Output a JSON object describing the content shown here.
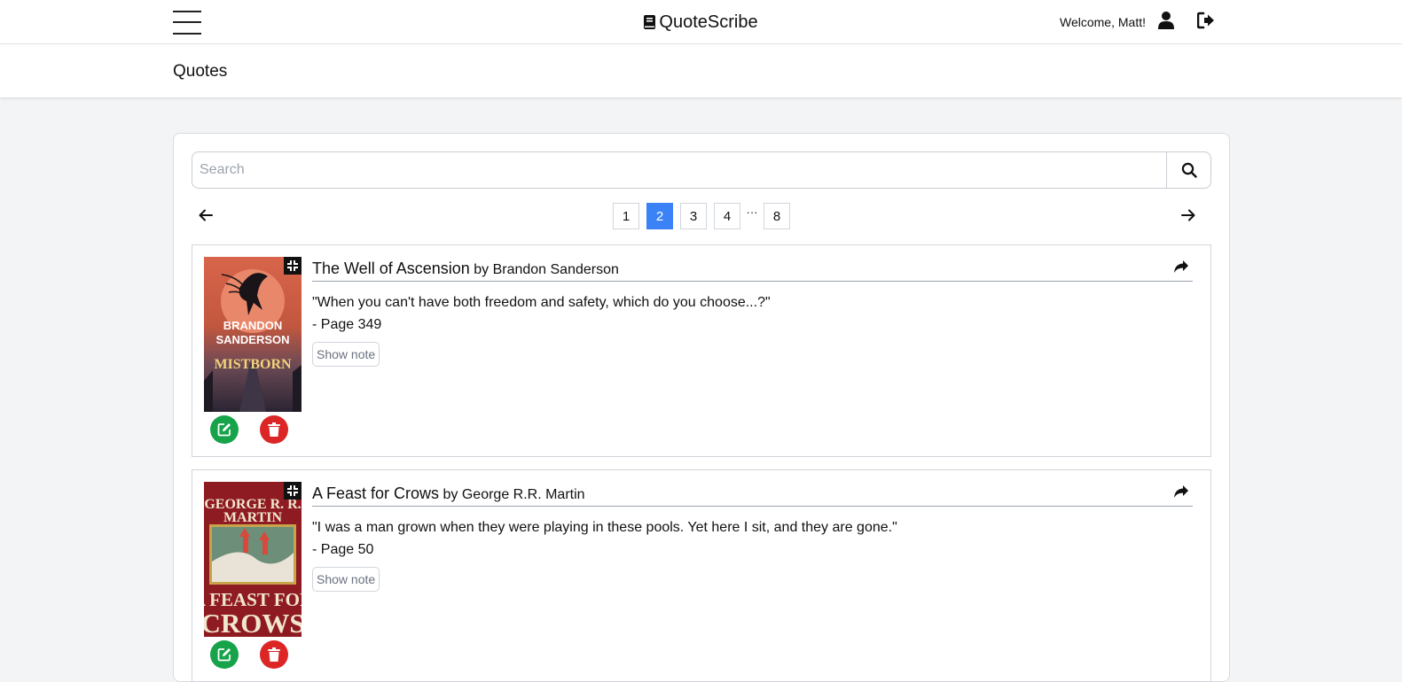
{
  "app": {
    "brand": "QuoteScribe",
    "welcome": "Welcome, Matt!"
  },
  "header": {
    "title": "Quotes"
  },
  "search": {
    "placeholder": "Search"
  },
  "pagination": {
    "pages": [
      "1",
      "2",
      "3",
      "4",
      "8"
    ],
    "ellipsis": "···",
    "current": "2"
  },
  "quotes": [
    {
      "title": "The Well of Ascension",
      "author": "by Brandon Sanderson",
      "quote": "\"When you can't have both freedom and safety, which do you choose...?\"",
      "page": "- Page 349",
      "note_label": "Show note",
      "cover": {
        "line1": "BRANDON",
        "line2": "SANDERSON",
        "line3": "MISTBORN",
        "colors": [
          "#e07a5f",
          "#3a2a3f"
        ]
      }
    },
    {
      "title": "A Feast for Crows",
      "author": "by George R.R. Martin",
      "quote": "\"I was a man grown when they were playing in these pools. Yet here I sit, and they are gone.\"",
      "page": "- Page 50",
      "note_label": "Show note",
      "cover": {
        "line1": "GEORGE R. R.",
        "line2": "MARTIN",
        "line3": "A FEAST FOR",
        "line4": "CROWS",
        "colors": [
          "#8b1a1f",
          "#c9a34a"
        ]
      }
    }
  ],
  "colors": {
    "accent": "#3b82f6",
    "edit": "#16a34a",
    "delete": "#dc2626"
  }
}
